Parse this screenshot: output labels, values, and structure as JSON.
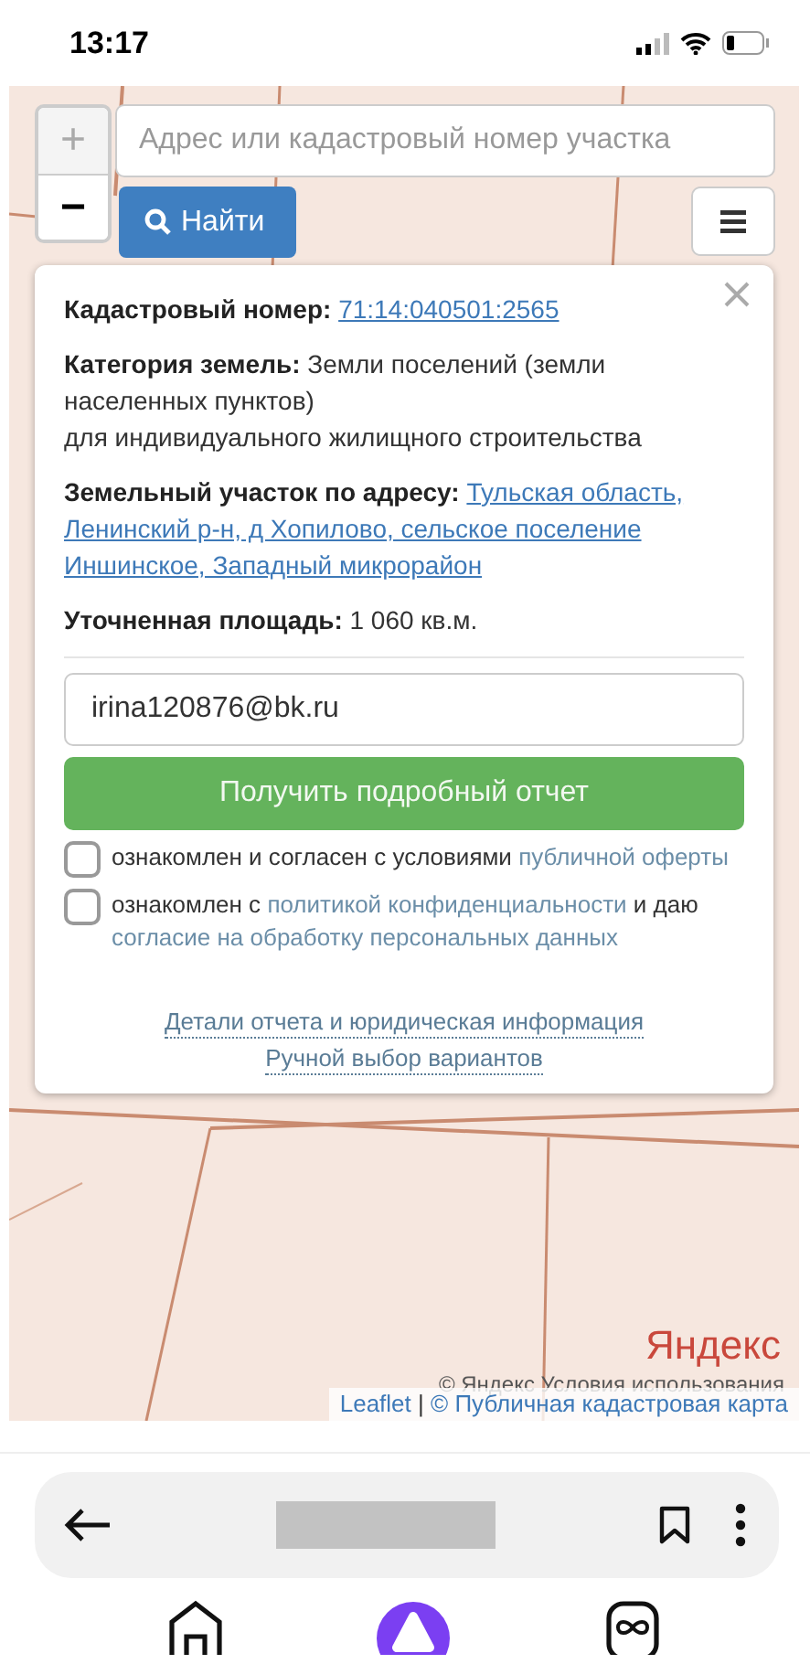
{
  "status_bar": {
    "time": "13:17"
  },
  "map": {
    "kind": "picture",
    "zoom_in": "+",
    "zoom_out": "−",
    "search": {
      "placeholder": "Адрес или кадастровый номер участка"
    },
    "find_button": "Найти",
    "popup": {
      "fields": [
        {
          "label": "Кадастровый номер:",
          "value": "71:14:040501:2565",
          "kind": "link"
        },
        {
          "label": "Категория земель:",
          "value": "Земли поселений (земли населенных пунктов)\nдля индивидуального жилищного строительства",
          "kind": "plain"
        },
        {
          "label": "Земельный участок по адресу:",
          "value": [
            "Тульская область,",
            "Ленинский р-н, д Хопилово, сельское поселение",
            "Иншинское, Западный микрорайон"
          ],
          "kind": "link_lines"
        },
        {
          "label": "Уточненная площадь:",
          "value": "1 060 кв.м.",
          "kind": "plain"
        }
      ],
      "email": "irina120876@bk.ru",
      "submit": "Получить подробный отчет",
      "consents": [
        {
          "checked": false,
          "parts": [
            {
              "text": "ознакомлен и согласен с условиями ",
              "kind": "plain"
            },
            {
              "text": "публичной оферты",
              "kind": "link"
            }
          ]
        },
        {
          "checked": false,
          "parts": [
            {
              "text": "ознакомлен с ",
              "kind": "plain"
            },
            {
              "text": "политикой конфиденциальности",
              "kind": "link"
            },
            {
              "text": " и даю ",
              "kind": "plain"
            },
            {
              "text": "согласие на обработку персональных данных",
              "kind": "link"
            }
          ]
        }
      ],
      "footer_links": [
        "Детали отчета и юридическая информация",
        "Ручной выбор вариантов"
      ]
    },
    "yandex_logo": "Яндекс",
    "yandex_terms": "© Яндекс  Условия использования",
    "attribution": [
      {
        "text": "Leaflet",
        "kind": "link"
      },
      {
        "text": " | ",
        "kind": "plain"
      },
      {
        "text": "© Публичная кадастровая карта",
        "kind": "link"
      }
    ]
  }
}
